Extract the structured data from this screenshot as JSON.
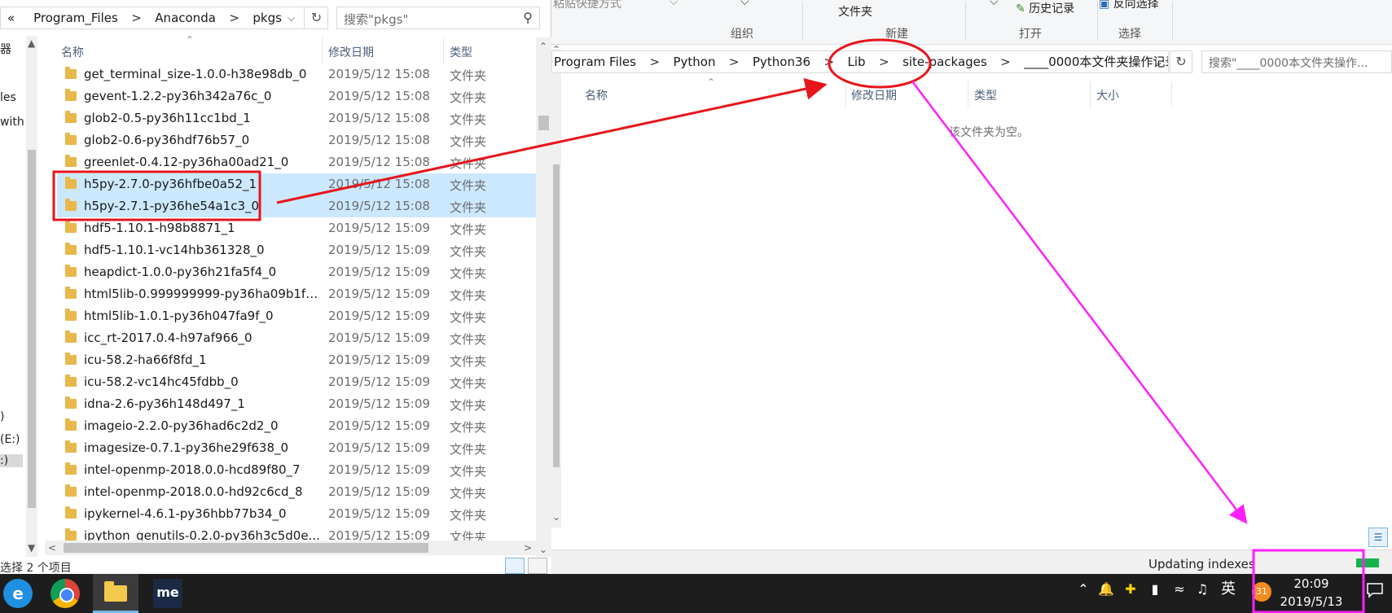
{
  "left": {
    "breadcrumb": {
      "more": "«",
      "parts": [
        "Program_Files",
        "Anaconda",
        "pkgs"
      ],
      "sep": ">"
    },
    "search_placeholder": "搜索\"pkgs\"",
    "nav_items": [
      "器 ",
      "les",
      "with",
      ")",
      "(E:)",
      ":)"
    ],
    "columns": {
      "name": "名称",
      "date": "修改日期",
      "type": "类型"
    },
    "rows": [
      {
        "name": "get_terminal_size-1.0.0-h38e98db_0",
        "date": "2019/5/12 15:08",
        "type": "文件夹",
        "selected": false
      },
      {
        "name": "gevent-1.2.2-py36h342a76c_0",
        "date": "2019/5/12 15:08",
        "type": "文件夹",
        "selected": false
      },
      {
        "name": "glob2-0.5-py36h11cc1bd_1",
        "date": "2019/5/12 15:08",
        "type": "文件夹",
        "selected": false
      },
      {
        "name": "glob2-0.6-py36hdf76b57_0",
        "date": "2019/5/12 15:08",
        "type": "文件夹",
        "selected": false
      },
      {
        "name": "greenlet-0.4.12-py36ha00ad21_0",
        "date": "2019/5/12 15:08",
        "type": "文件夹",
        "selected": false
      },
      {
        "name": "h5py-2.7.0-py36hfbe0a52_1",
        "date": "2019/5/12 15:08",
        "type": "文件夹",
        "selected": true
      },
      {
        "name": "h5py-2.7.1-py36he54a1c3_0",
        "date": "2019/5/12 15:08",
        "type": "文件夹",
        "selected": true
      },
      {
        "name": "hdf5-1.10.1-h98b8871_1",
        "date": "2019/5/12 15:09",
        "type": "文件夹",
        "selected": false
      },
      {
        "name": "hdf5-1.10.1-vc14hb361328_0",
        "date": "2019/5/12 15:09",
        "type": "文件夹",
        "selected": false
      },
      {
        "name": "heapdict-1.0.0-py36h21fa5f4_0",
        "date": "2019/5/12 15:09",
        "type": "文件夹",
        "selected": false
      },
      {
        "name": "html5lib-0.999999999-py36ha09b1f3...",
        "date": "2019/5/12 15:09",
        "type": "文件夹",
        "selected": false
      },
      {
        "name": "html5lib-1.0.1-py36h047fa9f_0",
        "date": "2019/5/12 15:09",
        "type": "文件夹",
        "selected": false
      },
      {
        "name": "icc_rt-2017.0.4-h97af966_0",
        "date": "2019/5/12 15:09",
        "type": "文件夹",
        "selected": false
      },
      {
        "name": "icu-58.2-ha66f8fd_1",
        "date": "2019/5/12 15:09",
        "type": "文件夹",
        "selected": false
      },
      {
        "name": "icu-58.2-vc14hc45fdbb_0",
        "date": "2019/5/12 15:09",
        "type": "文件夹",
        "selected": false
      },
      {
        "name": "idna-2.6-py36h148d497_1",
        "date": "2019/5/12 15:09",
        "type": "文件夹",
        "selected": false
      },
      {
        "name": "imageio-2.2.0-py36had6c2d2_0",
        "date": "2019/5/12 15:09",
        "type": "文件夹",
        "selected": false
      },
      {
        "name": "imagesize-0.7.1-py36he29f638_0",
        "date": "2019/5/12 15:09",
        "type": "文件夹",
        "selected": false
      },
      {
        "name": "intel-openmp-2018.0.0-hcd89f80_7",
        "date": "2019/5/12 15:09",
        "type": "文件夹",
        "selected": false
      },
      {
        "name": "intel-openmp-2018.0.0-hd92c6cd_8",
        "date": "2019/5/12 15:09",
        "type": "文件夹",
        "selected": false
      },
      {
        "name": "ipykernel-4.6.1-py36hbb77b34_0",
        "date": "2019/5/12 15:09",
        "type": "文件夹",
        "selected": false
      },
      {
        "name": "ipython_genutils-0.2.0-py36h3c5d0e...",
        "date": "2019/5/12 15:09",
        "type": "文件夹",
        "selected": false
      }
    ],
    "status": "选择 2 个项目"
  },
  "right": {
    "ribbon": {
      "paste_shortcut": "粘贴快捷方式",
      "new_folder": "文件夹",
      "history": "历史记录",
      "invert_select": "反向选择",
      "group_organize": "组织",
      "group_new": "新建",
      "group_open": "打开",
      "group_select": "选择"
    },
    "breadcrumb": {
      "parts": [
        "Program Files",
        "Python",
        "Python36",
        "Lib",
        "site-packages",
        "____0000本文件夹操作记录"
      ],
      "sep": ">"
    },
    "search_placeholder": "搜索\"____0000本文件夹操作...",
    "columns": {
      "name": "名称",
      "date": "修改日期",
      "type": "类型",
      "size": "大小"
    },
    "empty_message": "该文件夹为空。",
    "status_updating": "Updating indexes"
  },
  "taskbar": {
    "me_label": "me",
    "ime": "英",
    "badge": "31",
    "time": "20:09",
    "date": "2019/5/13"
  },
  "colors": {
    "selection": "#cce8ff",
    "annotation_red": "#e8141b",
    "annotation_magenta": "#ff20ff",
    "taskbar": "#1d1d1d"
  }
}
